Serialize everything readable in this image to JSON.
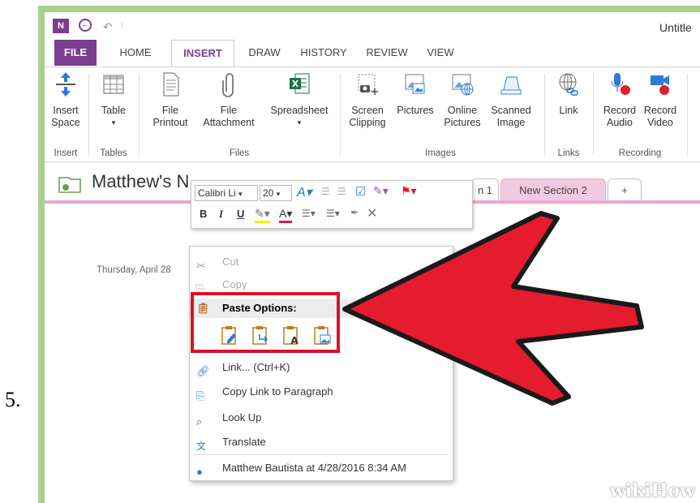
{
  "step_number": "5.",
  "window": {
    "title": "Untitle",
    "icons": [
      "onenote-logo-icon",
      "back-icon",
      "undo-icon",
      "customize-qat-icon"
    ]
  },
  "ribbon_tabs": [
    "FILE",
    "HOME",
    "INSERT",
    "DRAW",
    "HISTORY",
    "REVIEW",
    "VIEW"
  ],
  "active_tab": "INSERT",
  "ribbon": {
    "buttons": [
      {
        "label": "Insert Space",
        "line1": "Insert",
        "line2": "Space",
        "icon": "insert-space-icon"
      },
      {
        "label": "Table",
        "line1": "Table",
        "line2": "▾",
        "icon": "table-icon"
      },
      {
        "label": "File Printout",
        "line1": "File",
        "line2": "Printout",
        "icon": "file-printout-icon"
      },
      {
        "label": "File Attachment",
        "line1": "File",
        "line2": "Attachment",
        "icon": "paperclip-icon"
      },
      {
        "label": "Spreadsheet",
        "line1": "Spreadsheet",
        "line2": "▾",
        "icon": "excel-icon"
      },
      {
        "label": "Screen Clipping",
        "line1": "Screen",
        "line2": "Clipping",
        "icon": "screen-clipping-icon"
      },
      {
        "label": "Pictures",
        "line1": "Pictures",
        "line2": "",
        "icon": "pictures-icon"
      },
      {
        "label": "Online Pictures",
        "line1": "Online",
        "line2": "Pictures",
        "icon": "online-pictures-icon"
      },
      {
        "label": "Scanned Image",
        "line1": "Scanned",
        "line2": "Image",
        "icon": "scanner-icon"
      },
      {
        "label": "Link",
        "line1": "Link",
        "line2": "",
        "icon": "link-globe-icon"
      },
      {
        "label": "Record Audio",
        "line1": "Record",
        "line2": "Audio",
        "icon": "microphone-icon"
      },
      {
        "label": "Record Video",
        "line1": "Record",
        "line2": "Video",
        "icon": "video-camera-icon"
      }
    ],
    "groups": [
      "Insert",
      "Tables",
      "Files",
      "Images",
      "Links",
      "Recording"
    ]
  },
  "notebook": {
    "title": "Matthew's N",
    "sections": [
      "n 1",
      "New Section 2",
      "+"
    ],
    "active_section": "New Section 2"
  },
  "page_date": "Thursday, April 28",
  "mini_toolbar": {
    "font": "Calibri Li",
    "size": "20",
    "row2": [
      "B",
      "I",
      "U"
    ]
  },
  "context_menu": {
    "cut": "Cut",
    "copy": "Copy",
    "paste_header": "Paste Options:",
    "paste_icons": [
      "paste-keep-formatting-icon",
      "paste-merge-formatting-icon",
      "paste-text-only-icon",
      "paste-picture-icon"
    ],
    "link": "Link...  (Ctrl+K)",
    "copy_link": "Copy Link to Paragraph",
    "lookup": "Look Up",
    "translate": "Translate",
    "author": "Matthew Bautista at 4/28/2016 8:34 AM"
  },
  "colors": {
    "frame_green": "#a9cf8e",
    "onenote_purple": "#7a3d8f",
    "section_pink": "#f2c9e0",
    "highlight_red": "#d9122b",
    "arrow_red": "#e51b2e"
  },
  "watermark": "wikiHow"
}
